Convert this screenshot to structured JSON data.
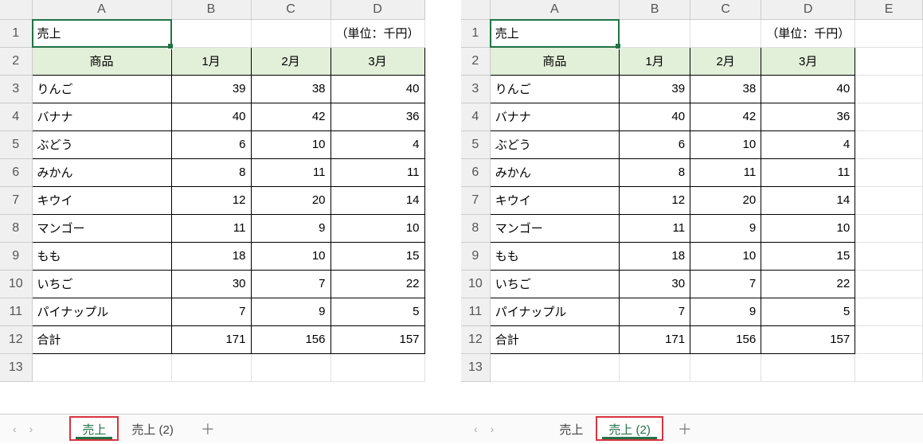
{
  "columns": [
    "A",
    "B",
    "C",
    "D",
    "E"
  ],
  "rownums": [
    "1",
    "2",
    "3",
    "4",
    "5",
    "6",
    "7",
    "8",
    "9",
    "10",
    "11",
    "12",
    "13"
  ],
  "row1": {
    "A": "売上",
    "note": "（単位：千円）"
  },
  "headers": {
    "A": "商品",
    "B": "1月",
    "C": "2月",
    "D": "3月"
  },
  "data_rows": [
    {
      "name": "りんご",
      "m1": "39",
      "m2": "38",
      "m3": "40"
    },
    {
      "name": "バナナ",
      "m1": "40",
      "m2": "42",
      "m3": "36"
    },
    {
      "name": "ぶどう",
      "m1": "6",
      "m2": "10",
      "m3": "4"
    },
    {
      "name": "みかん",
      "m1": "8",
      "m2": "11",
      "m3": "11"
    },
    {
      "name": "キウイ",
      "m1": "12",
      "m2": "20",
      "m3": "14"
    },
    {
      "name": "マンゴー",
      "m1": "11",
      "m2": "9",
      "m3": "10"
    },
    {
      "name": "もも",
      "m1": "18",
      "m2": "10",
      "m3": "15"
    },
    {
      "name": "いちご",
      "m1": "30",
      "m2": "7",
      "m3": "22"
    },
    {
      "name": "パイナップル",
      "m1": "7",
      "m2": "9",
      "m3": "5"
    },
    {
      "name": "合計",
      "m1": "171",
      "m2": "156",
      "m3": "157"
    }
  ],
  "left_panel": {
    "tabs": [
      "売上",
      "売上 (2)"
    ],
    "active_tab": "売上",
    "highlight_tab": "売上"
  },
  "right_panel": {
    "tabs": [
      "売上",
      "売上 (2)"
    ],
    "active_tab": "売上 (2)",
    "highlight_tab": "売上 (2)"
  },
  "nav": {
    "prev": "‹",
    "next": "›",
    "plus": "＋"
  }
}
